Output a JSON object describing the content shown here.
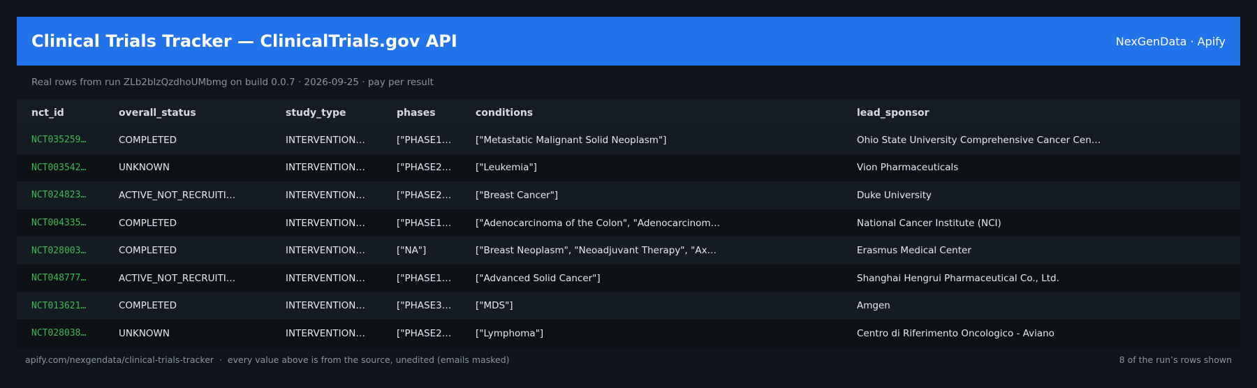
{
  "header": {
    "title": "Clinical Trials Tracker — ClinicalTrials.gov API",
    "brand": "NexGenData · Apify"
  },
  "subtitle": "Real rows from run ZLb2bIzQzdhoUMbmg on build 0.0.7 · 2026-09-25 · pay per result",
  "table": {
    "columns": [
      "nct_id",
      "overall_status",
      "study_type",
      "phases",
      "conditions",
      "lead_sponsor"
    ],
    "rows": [
      {
        "nct_id": "NCT035259…",
        "overall_status": "COMPLETED",
        "study_type": "INTERVENTION…",
        "phases": "[\"PHASE1…",
        "conditions": "[\"Metastatic Malignant Solid Neoplasm\"]",
        "lead_sponsor": "Ohio State University Comprehensive Cancer Cen…"
      },
      {
        "nct_id": "NCT003542…",
        "overall_status": "UNKNOWN",
        "study_type": "INTERVENTION…",
        "phases": "[\"PHASE2…",
        "conditions": "[\"Leukemia\"]",
        "lead_sponsor": "Vion Pharmaceuticals"
      },
      {
        "nct_id": "NCT024823…",
        "overall_status": "ACTIVE_NOT_RECRUITI…",
        "study_type": "INTERVENTION…",
        "phases": "[\"PHASE2…",
        "conditions": "[\"Breast Cancer\"]",
        "lead_sponsor": "Duke University"
      },
      {
        "nct_id": "NCT004335…",
        "overall_status": "COMPLETED",
        "study_type": "INTERVENTION…",
        "phases": "[\"PHASE1…",
        "conditions": "[\"Adenocarcinoma of the Colon\", \"Adenocarcinom…",
        "lead_sponsor": "National Cancer Institute (NCI)"
      },
      {
        "nct_id": "NCT028003…",
        "overall_status": "COMPLETED",
        "study_type": "INTERVENTION…",
        "phases": "[\"NA\"]",
        "conditions": "[\"Breast Neoplasm\", \"Neoadjuvant Therapy\", \"Ax…",
        "lead_sponsor": "Erasmus Medical Center"
      },
      {
        "nct_id": "NCT048777…",
        "overall_status": "ACTIVE_NOT_RECRUITI…",
        "study_type": "INTERVENTION…",
        "phases": "[\"PHASE1…",
        "conditions": "[\"Advanced Solid Cancer\"]",
        "lead_sponsor": "Shanghai Hengrui Pharmaceutical Co., Ltd."
      },
      {
        "nct_id": "NCT013621…",
        "overall_status": "COMPLETED",
        "study_type": "INTERVENTION…",
        "phases": "[\"PHASE3…",
        "conditions": "[\"MDS\"]",
        "lead_sponsor": "Amgen"
      },
      {
        "nct_id": "NCT028038…",
        "overall_status": "UNKNOWN",
        "study_type": "INTERVENTION…",
        "phases": "[\"PHASE2…",
        "conditions": "[\"Lymphoma\"]",
        "lead_sponsor": "Centro di Riferimento Oncologico - Aviano"
      }
    ]
  },
  "footer": {
    "left": "apify.com/nexgendata/clinical-trials-tracker  ·  every value above is from the source, unedited (emails masked)",
    "right": "8 of the run’s rows shown"
  },
  "colors": {
    "background": "#0f141b",
    "header": "#2272ea",
    "id_text": "#3fb950",
    "muted_text": "#8b949e"
  }
}
